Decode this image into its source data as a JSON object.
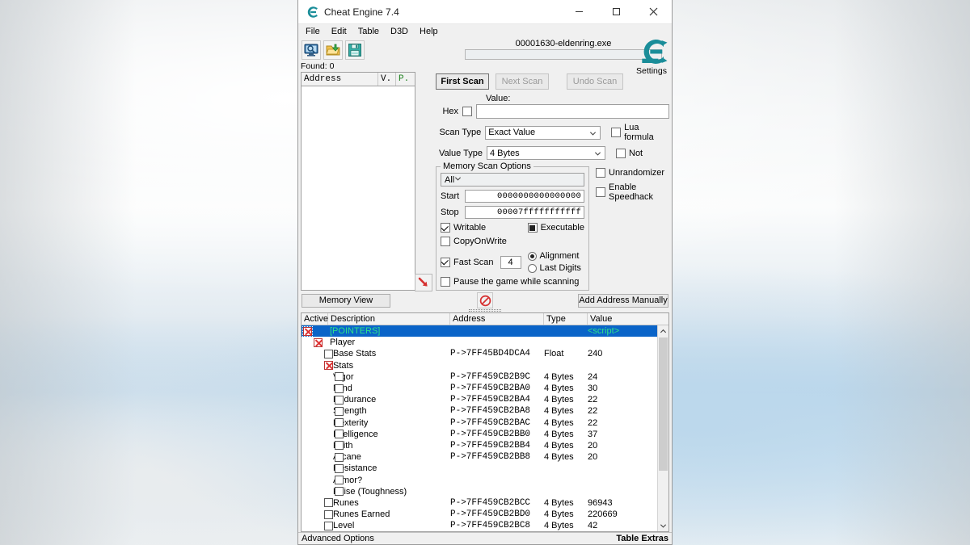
{
  "window": {
    "title": "Cheat Engine 7.4",
    "logo_icon": "cheat-engine-logo-icon",
    "minimize": "—",
    "maximize": "☐",
    "close": "✕"
  },
  "menubar": {
    "items": [
      "File",
      "Edit",
      "Table",
      "D3D",
      "Help"
    ]
  },
  "toolbar": {
    "buttons": [
      {
        "icon": "open-process-icon"
      },
      {
        "icon": "open-folder-icon"
      },
      {
        "icon": "save-table-icon"
      }
    ],
    "process_name": "00001630-eldenring.exe",
    "settings_label": "Settings",
    "settings_icon": "cheat-engine-settings-icon"
  },
  "found": "Found: 0",
  "results": {
    "columns": [
      "Address",
      "V.",
      "P."
    ],
    "rows": [],
    "arrow_icon": "red-arrow-down-right-icon"
  },
  "scan": {
    "first_scan": "First Scan",
    "next_scan": "Next Scan",
    "undo_scan": "Undo Scan",
    "value_label": "Value:",
    "hex_label": "Hex",
    "hex_checked": false,
    "value_text": "",
    "scan_type_label": "Scan Type",
    "scan_type": "Exact Value",
    "value_type_label": "Value Type",
    "value_type": "4 Bytes",
    "lua_formula_label": "Lua formula",
    "lua_formula_checked": false,
    "not_label": "Not",
    "not_checked": false
  },
  "memory_scan_options": {
    "title": "Memory Scan Options",
    "region": "All",
    "start_label": "Start",
    "start_value": "0000000000000000",
    "stop_label": "Stop",
    "stop_value": "00007fffffffffff",
    "writable_label": "Writable",
    "writable_checked": true,
    "executable_label": "Executable",
    "executable_state": "filled",
    "copyonwrite_label": "CopyOnWrite",
    "copyonwrite_checked": false,
    "fast_scan_label": "Fast Scan",
    "fast_scan_checked": true,
    "fast_scan_value": "4",
    "alignment_label": "Alignment",
    "last_digits_label": "Last Digits",
    "alignment_selected": true,
    "pause_label": "Pause the game while scanning",
    "pause_checked": false,
    "unrandomizer_label": "Unrandomizer",
    "unrandomizer_checked": false,
    "speedhack_label": "Enable Speedhack",
    "speedhack_checked": false
  },
  "mid_buttons": {
    "memory_view": "Memory View",
    "add_address": "Add Address Manually",
    "stop_icon": "no-entry-icon"
  },
  "address_table": {
    "columns": [
      "Active",
      "Description",
      "Address",
      "Type",
      "Value"
    ],
    "rows": [
      {
        "indent": 0,
        "check": "x",
        "description": "[POINTERS]",
        "address": "",
        "type": "",
        "value": "<script>",
        "selected": true
      },
      {
        "indent": 1,
        "check": "x",
        "description": "Player",
        "address": "",
        "type": "",
        "value": ""
      },
      {
        "indent": 2,
        "check": "none",
        "description": "Base Stats",
        "address": "P->7FF45BD4DCA4",
        "type": "Float",
        "value": "240"
      },
      {
        "indent": 2,
        "check": "x",
        "description": "Stats",
        "address": "",
        "type": "",
        "value": ""
      },
      {
        "indent": 3,
        "check": "none",
        "description": "Vigor",
        "address": "P->7FF459CB2B9C",
        "type": "4 Bytes",
        "value": "24"
      },
      {
        "indent": 3,
        "check": "none",
        "description": "Mind",
        "address": "P->7FF459CB2BA0",
        "type": "4 Bytes",
        "value": "30"
      },
      {
        "indent": 3,
        "check": "none",
        "description": "Endurance",
        "address": "P->7FF459CB2BA4",
        "type": "4 Bytes",
        "value": "22"
      },
      {
        "indent": 3,
        "check": "none",
        "description": "Strength",
        "address": "P->7FF459CB2BA8",
        "type": "4 Bytes",
        "value": "22"
      },
      {
        "indent": 3,
        "check": "none",
        "description": "Dexterity",
        "address": "P->7FF459CB2BAC",
        "type": "4 Bytes",
        "value": "22"
      },
      {
        "indent": 3,
        "check": "none",
        "description": "Intelligence",
        "address": "P->7FF459CB2BB0",
        "type": "4 Bytes",
        "value": "37"
      },
      {
        "indent": 3,
        "check": "none",
        "description": "Faith",
        "address": "P->7FF459CB2BB4",
        "type": "4 Bytes",
        "value": "20"
      },
      {
        "indent": 3,
        "check": "none",
        "description": "Arcane",
        "address": "P->7FF459CB2BB8",
        "type": "4 Bytes",
        "value": "20"
      },
      {
        "indent": 3,
        "check": "none",
        "description": "Resistance",
        "address": "",
        "type": "",
        "value": ""
      },
      {
        "indent": 3,
        "check": "none",
        "description": "Armor?",
        "address": "",
        "type": "",
        "value": ""
      },
      {
        "indent": 3,
        "check": "none",
        "description": "Poise (Toughness)",
        "address": "",
        "type": "",
        "value": ""
      },
      {
        "indent": 2,
        "check": "none",
        "description": "Runes",
        "address": "P->7FF459CB2BCC",
        "type": "4 Bytes",
        "value": "96943"
      },
      {
        "indent": 2,
        "check": "none",
        "description": "Runes Earned",
        "address": "P->7FF459CB2BD0",
        "type": "4 Bytes",
        "value": "220669"
      },
      {
        "indent": 2,
        "check": "none",
        "description": "Level",
        "address": "P->7FF459CB2BC8",
        "type": "4 Bytes",
        "value": "42"
      }
    ],
    "scroll_up_icon": "chevron-up-icon",
    "scroll_down_icon": "chevron-down-icon"
  },
  "statusbar": {
    "advanced_options": "Advanced Options",
    "table_extras": "Table Extras"
  },
  "colors": {
    "selection": "#0a64c8",
    "selected_text": "#2ee38a",
    "ce_teal": "#1a8d99",
    "red": "#d33333"
  }
}
